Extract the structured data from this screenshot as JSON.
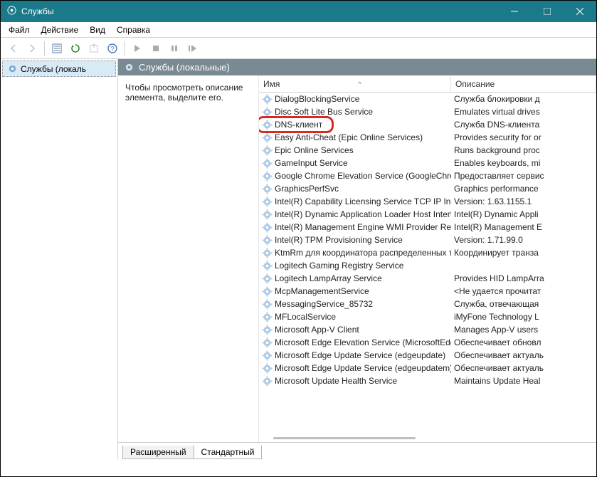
{
  "window": {
    "title": "Службы"
  },
  "menu": {
    "file": "Файл",
    "action": "Действие",
    "view": "Вид",
    "help": "Справка"
  },
  "leftpane": {
    "tree_label": "Службы (локаль"
  },
  "rightheader": {
    "title": "Службы (локальные)"
  },
  "desc_panel": {
    "line1": "Чтобы просмотреть описание",
    "line2": "элемента, выделите его."
  },
  "columns": {
    "name": "Имя",
    "desc": "Описание",
    "sort_indicator": "^"
  },
  "tabs": {
    "extended": "Расширенный",
    "standard": "Стандартный"
  },
  "services": [
    {
      "name": "DialogBlockingService",
      "desc": "Служба блокировки д"
    },
    {
      "name": "Disc Soft Lite Bus Service",
      "desc": "Emulates virtual drives"
    },
    {
      "name": "DNS-клиент",
      "desc": "Служба DNS-клиента"
    },
    {
      "name": "Easy Anti-Cheat (Epic Online Services)",
      "desc": "Provides security for or"
    },
    {
      "name": "Epic Online Services",
      "desc": "Runs background proc"
    },
    {
      "name": "GameInput Service",
      "desc": "Enables keyboards, mi"
    },
    {
      "name": "Google Chrome Elevation Service (GoogleChromeElev...",
      "desc": "Предоставляет сервис"
    },
    {
      "name": "GraphicsPerfSvc",
      "desc": "Graphics performance"
    },
    {
      "name": "Intel(R) Capability Licensing Service TCP IP Interface",
      "desc": "Version: 1.63.1155.1"
    },
    {
      "name": "Intel(R) Dynamic Application Loader Host Interface Ser...",
      "desc": "Intel(R) Dynamic Appli"
    },
    {
      "name": "Intel(R) Management Engine WMI Provider Registration",
      "desc": "Intel(R) Management E"
    },
    {
      "name": "Intel(R) TPM Provisioning Service",
      "desc": "Version: 1.71.99.0"
    },
    {
      "name": "KtmRm для координатора распределенных транзак...",
      "desc": "Координирует транза"
    },
    {
      "name": "Logitech Gaming Registry Service",
      "desc": ""
    },
    {
      "name": "Logitech LampArray Service",
      "desc": "Provides HID LampArra"
    },
    {
      "name": "McpManagementService",
      "desc": "<Не удается прочитат"
    },
    {
      "name": "MessagingService_85732",
      "desc": "Служба, отвечающая"
    },
    {
      "name": "MFLocalService",
      "desc": "iMyFone Technology L"
    },
    {
      "name": "Microsoft App-V Client",
      "desc": "Manages App-V users"
    },
    {
      "name": "Microsoft Edge Elevation Service (MicrosoftEdgeElevati...",
      "desc": "Обеспечивает обновл"
    },
    {
      "name": "Microsoft Edge Update Service (edgeupdate)",
      "desc": "Обеспечивает актуаль"
    },
    {
      "name": "Microsoft Edge Update Service (edgeupdatem)",
      "desc": "Обеспечивает актуаль"
    },
    {
      "name": "Microsoft Update Health Service",
      "desc": "Maintains Update Heal"
    }
  ]
}
